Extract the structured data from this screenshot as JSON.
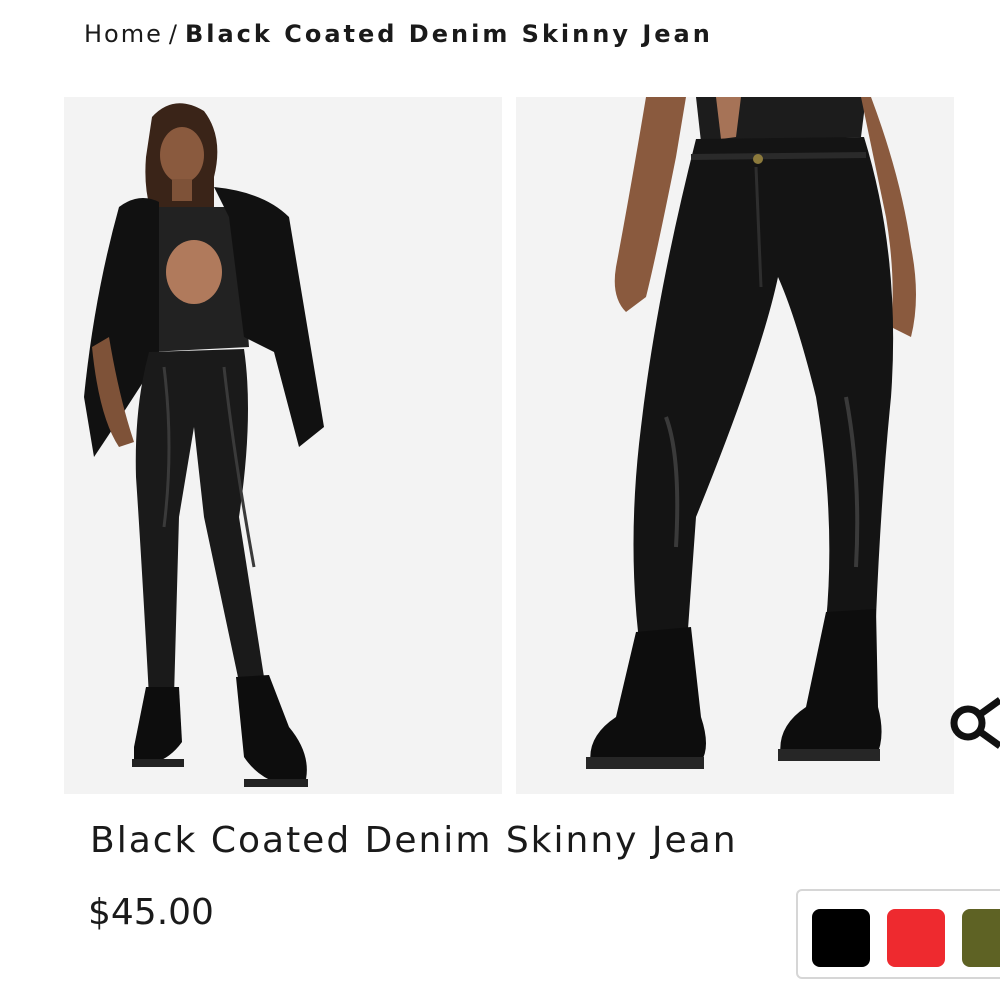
{
  "breadcrumb": {
    "home_label": "Home",
    "separator": "/",
    "current_label": "Black Coated Denim Skinny Jean"
  },
  "gallery": {
    "images": [
      {
        "alt": "model-full-body"
      },
      {
        "alt": "model-legs-closeup"
      }
    ]
  },
  "product": {
    "title": "Black Coated Denim Skinny Jean",
    "price": "$45.00"
  },
  "colors": {
    "swatches": [
      {
        "name": "black",
        "hex": "#000000"
      },
      {
        "name": "red",
        "hex": "#ee2a2f"
      },
      {
        "name": "khaki",
        "hex": "#5e6224"
      }
    ]
  },
  "icons": {
    "share": "share-icon"
  }
}
